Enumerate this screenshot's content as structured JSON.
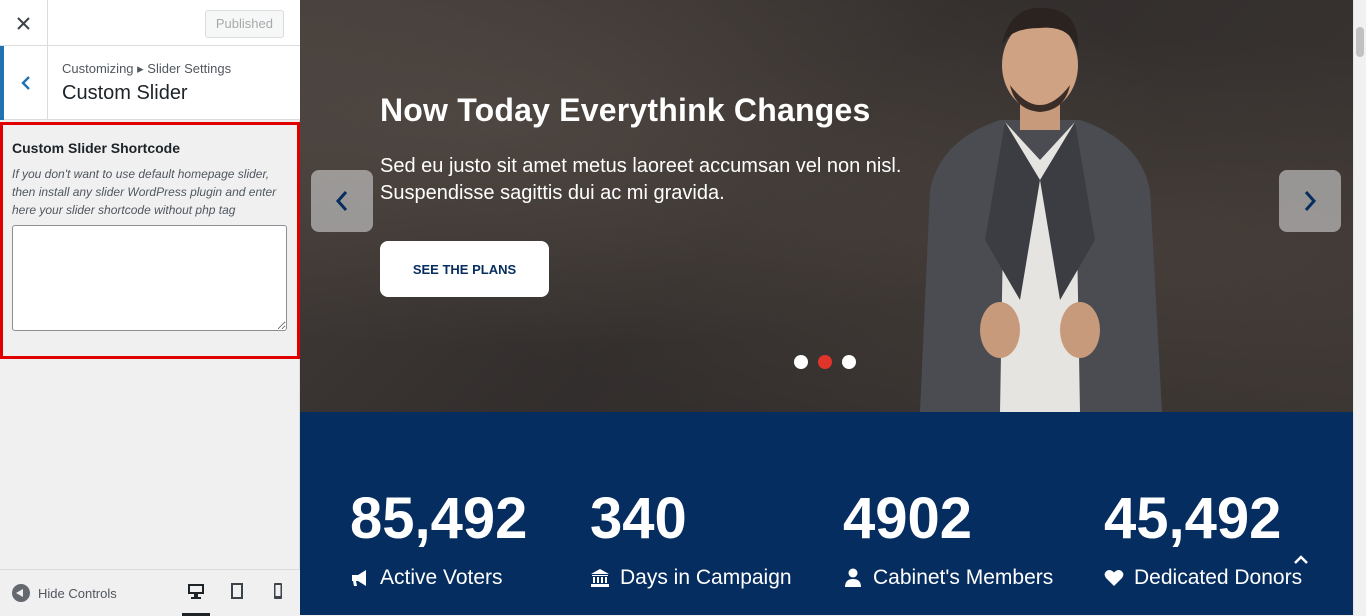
{
  "customizer": {
    "published_label": "Published",
    "breadcrumb": "Customizing ▸ Slider Settings",
    "section_title": "Custom Slider",
    "control": {
      "label": "Custom Slider Shortcode",
      "description": "If you don't want to use default homepage slider, then install any slider WordPress plugin and enter here your slider shortcode without php tag",
      "value": ""
    },
    "footer": {
      "hide_controls_label": "Hide Controls",
      "devices": [
        "desktop",
        "tablet",
        "mobile"
      ],
      "active_device": "desktop"
    }
  },
  "slider": {
    "title": "Now Today Everythink Changes",
    "subtitle": "Sed eu justo sit amet metus laoreet accumsan vel non nisl. Suspendisse sagittis dui ac mi gravida.",
    "button_label": "SEE THE PLANS",
    "dots": 3,
    "active_dot": 2
  },
  "stats": [
    {
      "number": "85,492",
      "label": "Active Voters",
      "icon": "megaphone-icon"
    },
    {
      "number": "340",
      "label": "Days in Campaign",
      "icon": "bank-icon"
    },
    {
      "number": "4902",
      "label": "Cabinet's Members",
      "icon": "user-icon"
    },
    {
      "number": "45,492",
      "label": "Dedicated Donors",
      "icon": "heart-icon"
    }
  ],
  "colors": {
    "accent": "#2271b1",
    "highlight_border": "#e00000",
    "stats_background": "#062d5f",
    "active_dot": "#e0342a"
  }
}
